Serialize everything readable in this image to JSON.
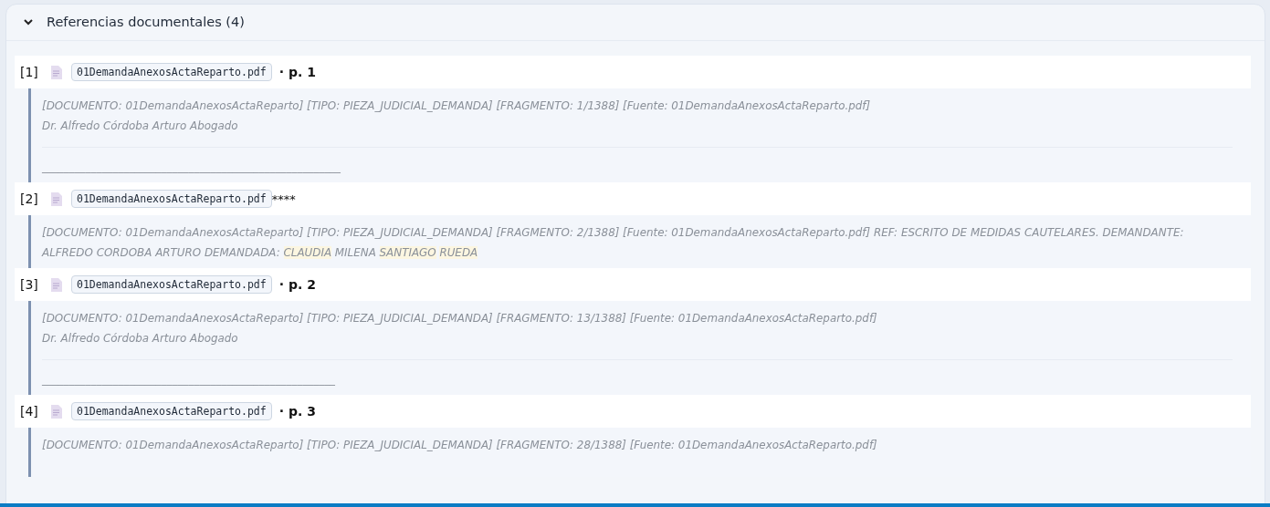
{
  "panel": {
    "expanded": true,
    "title": "Referencias documentales (4)"
  },
  "references": [
    {
      "index": "[1]",
      "file": "01DemandaAnexosActaReparto.pdf",
      "suffix": "· p. 1",
      "kind": "page",
      "quote": [
        {
          "kind": "line",
          "parts": [
            {
              "text": "[DOCUMENTO: 01DemandaAnexosActaReparto] [TIPO: PIEZA_JUDICIAL_DEMANDA] [FRAGMENTO: 1/1388] [Fuente: 01DemandaAnexosActaReparto.pdf]",
              "highlighted": false
            }
          ]
        },
        {
          "kind": "line",
          "parts": [
            {
              "text": "Dr. Alfredo Córdoba Arturo Abogado",
              "highlighted": false
            }
          ]
        },
        {
          "kind": "rule"
        },
        {
          "kind": "line",
          "parts": [
            {
              "text": "_______________________________________________________",
              "highlighted": false
            }
          ]
        }
      ]
    },
    {
      "index": "[2]",
      "file": "01DemandaAnexosActaReparto.pdf",
      "suffix": "****",
      "kind": "plain",
      "quote": [
        {
          "kind": "line",
          "parts": [
            {
              "text": "[DOCUMENTO: 01DemandaAnexosActaReparto] [TIPO: PIEZA_JUDICIAL_DEMANDA] [FRAGMENTO: 2/1388] [Fuente: 01DemandaAnexosActaReparto.pdf] REF: ESCRITO DE MEDIDAS CAUTELARES. DEMANDANTE: ALFREDO CORDOBA ARTURO DEMANDADA: ",
              "highlighted": false
            },
            {
              "text": "CLAUDIA",
              "highlighted": true
            },
            {
              "text": " MILENA ",
              "highlighted": false
            },
            {
              "text": "SANTIAGO",
              "highlighted": true
            },
            {
              "text": "RUEDA",
              "highlighted": true
            }
          ]
        }
      ]
    },
    {
      "index": "[3]",
      "file": "01DemandaAnexosActaReparto.pdf",
      "suffix": "· p. 2",
      "kind": "page",
      "quote": [
        {
          "kind": "line",
          "parts": [
            {
              "text": "[DOCUMENTO: 01DemandaAnexosActaReparto] [TIPO: PIEZA_JUDICIAL_DEMANDA] [FRAGMENTO: 13/1388] [Fuente: 01DemandaAnexosActaReparto.pdf]",
              "highlighted": false
            }
          ]
        },
        {
          "kind": "line",
          "parts": [
            {
              "text": "Dr. Alfredo Córdoba Arturo Abogado",
              "highlighted": false
            }
          ]
        },
        {
          "kind": "rule"
        },
        {
          "kind": "line",
          "parts": [
            {
              "text": "______________________________________________________",
              "highlighted": false
            }
          ]
        }
      ]
    },
    {
      "index": "[4]",
      "file": "01DemandaAnexosActaReparto.pdf",
      "suffix": "· p. 3",
      "kind": "page",
      "quote": [
        {
          "kind": "line",
          "parts": [
            {
              "text": "[DOCUMENTO: 01DemandaAnexosActaReparto] [TIPO: PIEZA_JUDICIAL_DEMANDA] [FRAGMENTO: 28/1388] [Fuente: 01DemandaAnexosActaReparto.pdf]",
              "highlighted": false
            }
          ]
        }
      ]
    }
  ]
}
